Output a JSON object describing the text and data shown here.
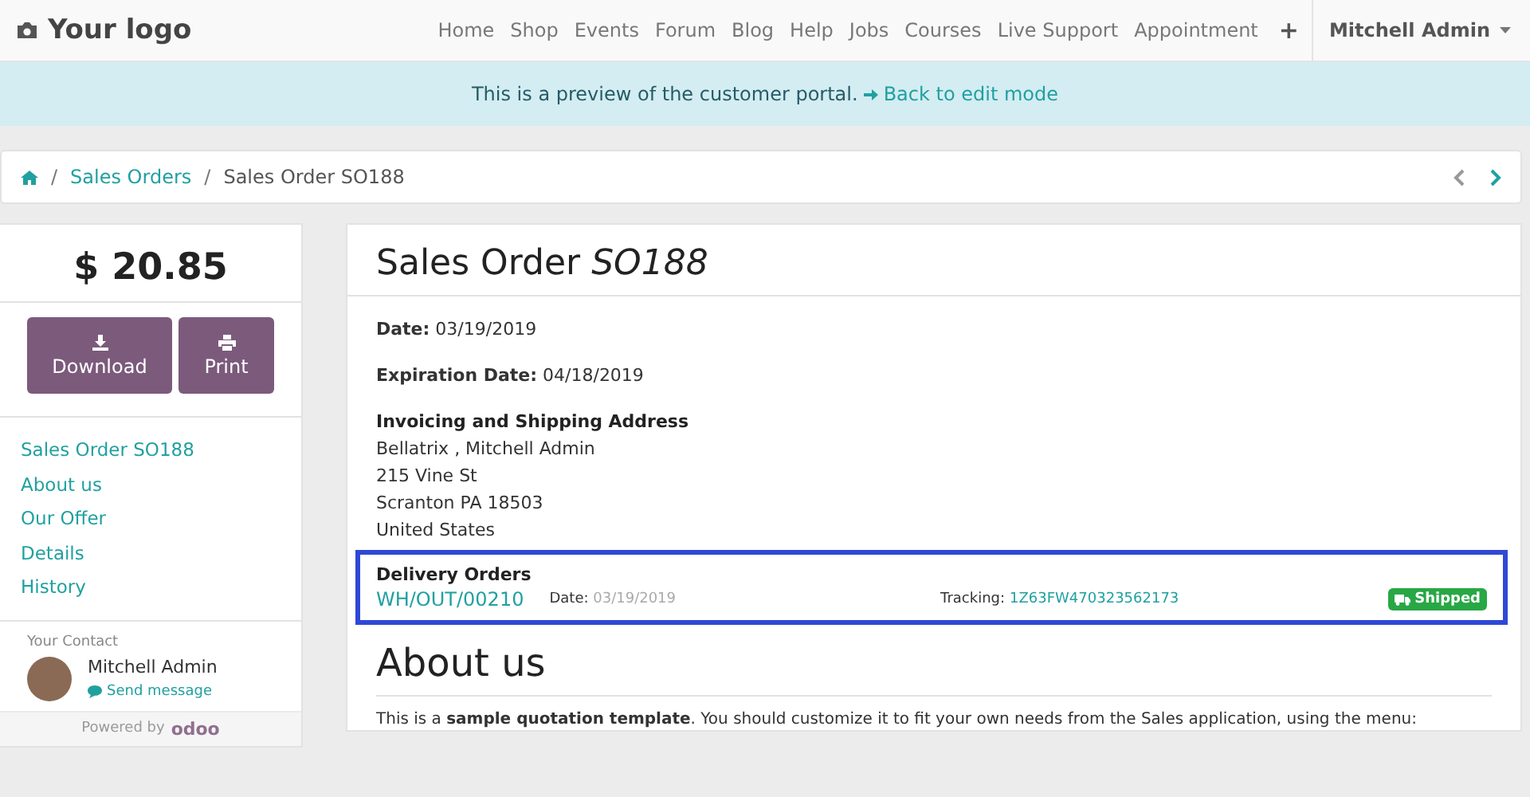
{
  "navbar": {
    "logo": "Your logo",
    "menu": [
      {
        "label": "Home",
        "selected": false
      },
      {
        "label": "Shop",
        "selected": false
      },
      {
        "label": "Events",
        "selected": false
      },
      {
        "label": "Forum",
        "selected": false
      },
      {
        "label": "Blog",
        "selected": false
      },
      {
        "label": "Help",
        "selected": false
      },
      {
        "label": "Jobs",
        "selected": false
      },
      {
        "label": "Courses",
        "selected": false
      },
      {
        "label": "Live Support",
        "selected": false
      },
      {
        "label": "Appointment",
        "selected": false
      }
    ],
    "add": "+",
    "user": "Mitchell Admin"
  },
  "banner": {
    "text": "This is a preview of the customer portal.",
    "link": "Back to edit mode"
  },
  "breadcrumb": [
    "/",
    "Sales Orders",
    "/",
    "Sales Order SO188"
  ],
  "sidebar": {
    "amount": "$ 20.85",
    "buttons": [
      "Download",
      "Print"
    ],
    "links": [
      "Sales Order SO188",
      "About us",
      "Our Offer",
      "Details",
      "History"
    ],
    "contact_label": "Your Contact",
    "contact_name": "Mitchell Admin",
    "send_message": "Send message",
    "powered_by": "Powered by",
    "brand": "odoo"
  },
  "order": {
    "title": "Sales Order",
    "number": "SO188",
    "date_label": "Date:",
    "date": "03/19/2019",
    "expiration_label": "Expiration Date:",
    "expiration": "04/18/2019",
    "address_heading": "Invoicing and Shipping Address",
    "address": [
      "Bellatrix , Mitchell Admin",
      "215 Vine St",
      "Scranton PA 18503",
      "United States"
    ],
    "delivery": {
      "heading": "Delivery Orders",
      "reference": "WH/OUT/00210",
      "date_label": "Date:",
      "date": "03/19/2019",
      "tracking_label": "Tracking:",
      "tracking": "1Z63FW470323562173",
      "status": "Shipped"
    },
    "about_heading": "About us",
    "about_text": "This is a **sample quotation template**. You should customize it to fit your own needs from the Sales application, using the menu:"
  }
}
